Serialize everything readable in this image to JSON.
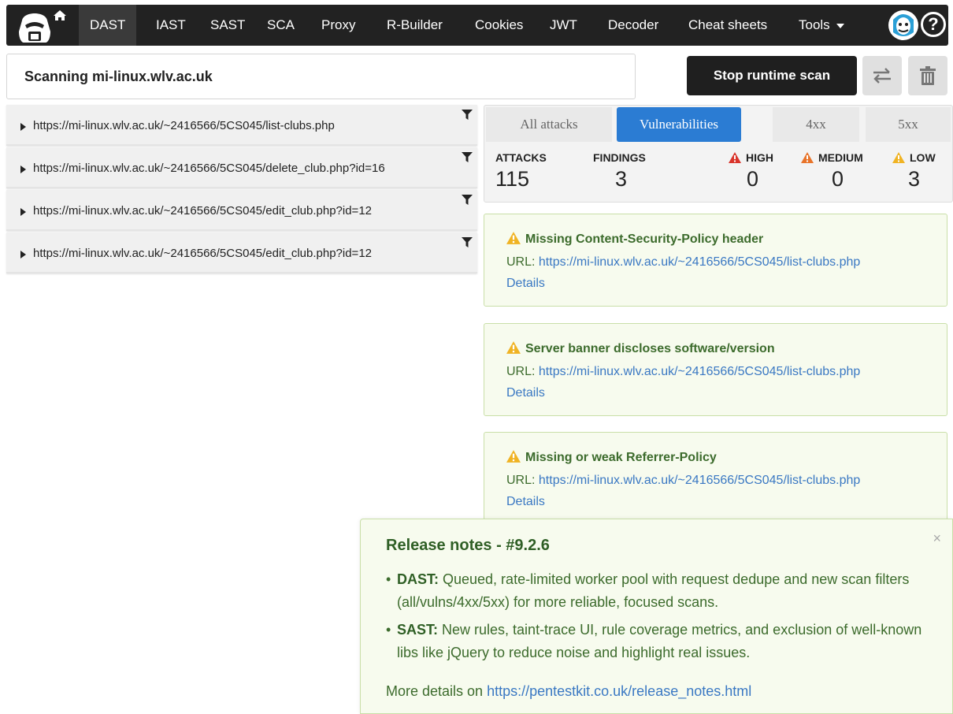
{
  "nav": {
    "items": [
      "DAST",
      "IAST",
      "SAST",
      "SCA",
      "Proxy",
      "R-Builder",
      "Cookies",
      "JWT",
      "Decoder",
      "Cheat sheets"
    ],
    "tools_label": "Tools",
    "active": "DAST"
  },
  "header": {
    "scan_title": "Scanning mi-linux.wlv.ac.uk",
    "stop_button": "Stop runtime scan"
  },
  "url_list": [
    "https://mi-linux.wlv.ac.uk/~2416566/5CS045/list-clubs.php",
    "https://mi-linux.wlv.ac.uk/~2416566/5CS045/delete_club.php?id=16",
    "https://mi-linux.wlv.ac.uk/~2416566/5CS045/edit_club.php?id=12",
    "https://mi-linux.wlv.ac.uk/~2416566/5CS045/edit_club.php?id=12"
  ],
  "tabs": [
    "All attacks",
    "Vulnerabilities",
    "4xx",
    "5xx"
  ],
  "active_tab": "Vulnerabilities",
  "stats": {
    "attacks_label": "ATTACKS",
    "attacks_value": "115",
    "findings_label": "FINDINGS",
    "findings_value": "3",
    "high_label": "HIGH",
    "high_value": "0",
    "medium_label": "MEDIUM",
    "medium_value": "0",
    "low_label": "LOW",
    "low_value": "3"
  },
  "findings": [
    {
      "title": "Missing Content-Security-Policy header",
      "url_label": "URL: ",
      "url": "https://mi-linux.wlv.ac.uk/~2416566/5CS045/list-clubs.php",
      "details": "Details"
    },
    {
      "title": "Server banner discloses software/version",
      "url_label": "URL: ",
      "url": "https://mi-linux.wlv.ac.uk/~2416566/5CS045/list-clubs.php",
      "details": "Details"
    },
    {
      "title": "Missing or weak Referrer-Policy",
      "url_label": "URL: ",
      "url": "https://mi-linux.wlv.ac.uk/~2416566/5CS045/list-clubs.php",
      "details": "Details"
    }
  ],
  "release_notes": {
    "title": "Release notes - #9.2.6",
    "close": "×",
    "items": [
      {
        "tag": "DAST:",
        "text": " Queued, rate-limited worker pool with request dedupe and new scan filters (all/vulns/4xx/5xx) for more reliable, focused scans."
      },
      {
        "tag": "SAST:",
        "text": " New rules, taint-trace UI, rule coverage metrics, and exclusion of well-known libs like jQuery to reduce noise and highlight real issues."
      }
    ],
    "more_prefix": "More details on ",
    "more_link": "https://pentestkit.co.uk/release_notes.html"
  },
  "colors": {
    "navbar": "#222222",
    "accent_blue": "#2b7cd3",
    "stop_button": "#1f1f1f",
    "finding_bg": "#f7fbee",
    "finding_text": "#3c6b2c",
    "link": "#3a78c3",
    "high": "#d9342b",
    "medium": "#e8742a",
    "low": "#f0b323"
  },
  "icons": {
    "logo": "hacker-hood-icon",
    "home": "home-icon",
    "swap": "swap-arrows-icon",
    "trash": "trash-icon",
    "help": "help-icon",
    "filter": "filter-icon",
    "warning": "warning-triangle-icon"
  }
}
